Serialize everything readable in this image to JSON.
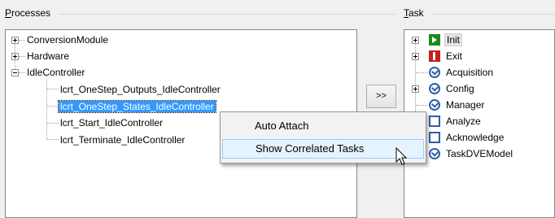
{
  "processes_group": {
    "label_accel": "P",
    "label_rest": "rocesses",
    "tree": [
      {
        "label": "ConversionModule",
        "expander": "plus"
      },
      {
        "label": "Hardware",
        "expander": "plus"
      },
      {
        "label": "IdleController",
        "expander": "minus"
      },
      {
        "label": "lcrt_OneStep_Outputs_IdleController"
      },
      {
        "label": "lcrt_OneStep_States_IdleController",
        "selected": true
      },
      {
        "label": "lcrt_Start_IdleController"
      },
      {
        "label": "lcrt_Terminate_IdleController"
      }
    ]
  },
  "task_group": {
    "label_accel": "T",
    "label_rest": "ask",
    "tree": [
      {
        "label": "Init",
        "icon": "init-icon",
        "expander": "plus",
        "selected": true
      },
      {
        "label": "Exit",
        "icon": "exit-icon",
        "expander": "plus"
      },
      {
        "label": "Acquisition",
        "icon": "clock-icon"
      },
      {
        "label": "Config",
        "icon": "clock-icon",
        "expander": "plus"
      },
      {
        "label": "Manager",
        "icon": "clock-icon"
      },
      {
        "label": "Analyze",
        "icon": "square-icon"
      },
      {
        "label": "Acknowledge",
        "icon": "square-icon"
      },
      {
        "label": "TaskDVEModel",
        "icon": "clock-icon"
      }
    ]
  },
  "assign_button": {
    "label": ">>"
  },
  "context_menu": {
    "items": [
      {
        "label": "Auto Attach"
      },
      {
        "label": "Show Correlated Tasks",
        "hover": true
      }
    ]
  }
}
